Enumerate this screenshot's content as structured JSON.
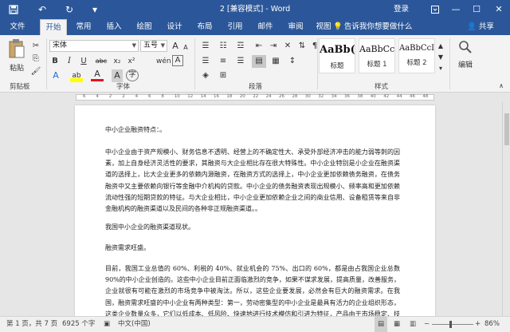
{
  "titlebar": {
    "title": "2 [兼容模式] - Word",
    "login": "登录"
  },
  "tabs": [
    {
      "label": "文件"
    },
    {
      "label": "开始"
    },
    {
      "label": "常用"
    },
    {
      "label": "插入"
    },
    {
      "label": "绘图"
    },
    {
      "label": "设计"
    },
    {
      "label": "布局"
    },
    {
      "label": "引用"
    },
    {
      "label": "邮件"
    },
    {
      "label": "审阅"
    },
    {
      "label": "视图"
    }
  ],
  "tell_me": "告诉我你想要做什么",
  "share": "共享",
  "ribbon": {
    "clipboard": {
      "paste": "粘贴",
      "label": "剪贴板"
    },
    "font": {
      "font_name": "宋体",
      "font_size": "五号",
      "label": "字体",
      "bold": "B",
      "italic": "I",
      "underline": "U",
      "strike": "abc",
      "subscript": "x₂",
      "superscript": "x²",
      "grow": "A",
      "shrink": "A",
      "clear": "A",
      "wen": "wén",
      "char_border": "A",
      "highlight": "ab",
      "font_color": "A",
      "shade": "A",
      "circle": "字"
    },
    "paragraph": {
      "label": "段落"
    },
    "styles": {
      "label": "样式",
      "items": [
        {
          "sample": "AaBb(",
          "name": "标题"
        },
        {
          "sample": "AaBbCc",
          "name": "标题 1"
        },
        {
          "sample": "AaBbCcI",
          "name": "标题 2"
        }
      ]
    },
    "editing": {
      "label": "编辑"
    }
  },
  "ruler_ticks": [
    "6",
    "4",
    "2",
    "2",
    "4",
    "6",
    "8",
    "10",
    "12",
    "14",
    "16",
    "18",
    "20",
    "22",
    "24",
    "26",
    "28",
    "30",
    "32",
    "34",
    "36",
    "38",
    "40",
    "42",
    "44",
    "46",
    "48"
  ],
  "document": {
    "paragraphs": [
      "中小企业融资特点：。",
      "中小企业由于资产规模小、财务信息不透明、经营上的不确定性大、承受外部经济冲击的能力弱等刺的因素，加上自身经济灵活性的要求，其融资与大企业相比存在很大特殊性。中小企业特别是小企业在融资渠道的选择上，比大企业更多的依赖内源融资，在融资方式的选择上，中小企业更加依赖债务融资，在债务融资中又主要依赖向银行等金融中介机构的贷款。中小企业的债务融资表现出规模小、频率高和更加依赖流动性强的短期贷款的特征。与大企业相比，中小企业更加依赖企业之间的商业信用、设备租赁等来自非金融机构的融资渠道以及民间的各种非正规融资渠道。。",
      "我国中小企业的融资渠道现状。",
      "融资需求旺盛。",
      "目前，我国工业总值的 60%、利税的 40%、就业机会的 75%、出口的 60%，都是由占我国企业总数 90%的中小企业创造的。这些中小企业目前正面临激烈的竞争，如果不谋求发展，提高质量，改善服务，企业就很有可能在激烈的市场竞争中被淘汰。所以，这些企业要发展，必然会有巨大的融资需求。在我国，融资需求旺盛的中小企业有两种类型：第一，劳动密集型的中小企业是最具有活力的企业组织形态，这类企业数量众多，它们以低成本、低风险、快速地进行技术模仿和引进为特征，产品由于市场稳定、技术成熟，"
    ]
  },
  "statusbar": {
    "page": "第 1 页，共 7 页",
    "words": "6925 个字",
    "language": "中文(中国)",
    "zoom": "86%"
  },
  "colors": {
    "brand": "#2b579a",
    "ribbon_bg": "#f3f3f3",
    "highlight": "#ffff00",
    "font_color": "#e81123"
  }
}
